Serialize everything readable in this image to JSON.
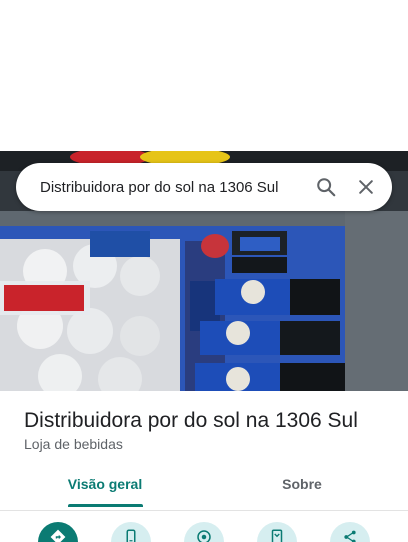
{
  "search": {
    "query": "Distribuidora por do sol na 1306 Sul",
    "search_icon": "search-icon",
    "close_icon": "close-icon"
  },
  "place": {
    "name": "Distribuidora por do sol na 1306 Sul",
    "category": "Loja de bebidas"
  },
  "tabs": [
    {
      "label": "Visão geral",
      "selected": true
    },
    {
      "label": "Sobre",
      "selected": false
    }
  ],
  "actions": [
    {
      "icon": "directions-icon"
    },
    {
      "icon": "phone-icon"
    },
    {
      "icon": "navigation-icon"
    },
    {
      "icon": "save-icon"
    },
    {
      "icon": "share-icon"
    }
  ],
  "colors": {
    "accent": "#0b7b73",
    "action_bg": "#d6eef0"
  }
}
